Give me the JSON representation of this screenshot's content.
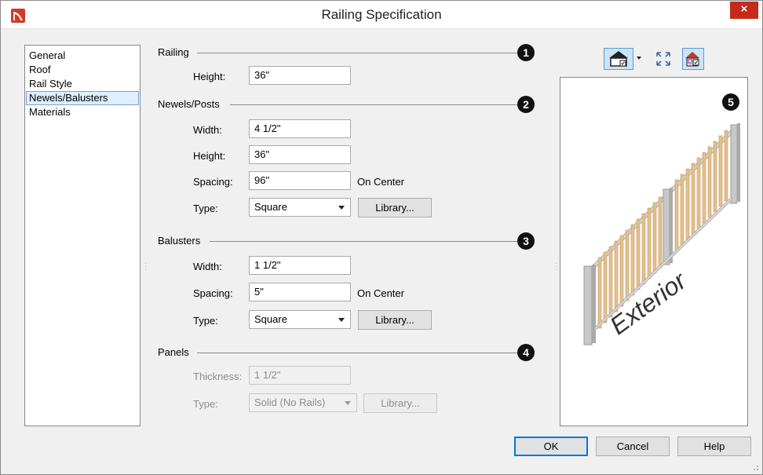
{
  "window": {
    "title": "Railing Specification",
    "close_glyph": "×"
  },
  "sidebar": {
    "items": [
      {
        "label": "General"
      },
      {
        "label": "Roof"
      },
      {
        "label": "Rail Style"
      },
      {
        "label": "Newels/Balusters",
        "selected": true
      },
      {
        "label": "Materials"
      }
    ]
  },
  "railing": {
    "title": "Railing",
    "badge": "1",
    "height_label": "Height:",
    "height_value": "36\""
  },
  "newels": {
    "title": "Newels/Posts",
    "badge": "2",
    "width_label": "Width:",
    "width_value": "4 1/2\"",
    "height_label": "Height:",
    "height_value": "36\"",
    "spacing_label": "Spacing:",
    "spacing_value": "96\"",
    "spacing_suffix": "On Center",
    "type_label": "Type:",
    "type_value": "Square",
    "library_label": "Library..."
  },
  "balusters": {
    "title": "Balusters",
    "badge": "3",
    "width_label": "Width:",
    "width_value": "1 1/2\"",
    "spacing_label": "Spacing:",
    "spacing_value": "5\"",
    "spacing_suffix": "On Center",
    "type_label": "Type:",
    "type_value": "Square",
    "library_label": "Library..."
  },
  "panels": {
    "title": "Panels",
    "badge": "4",
    "thickness_label": "Thickness:",
    "thickness_value": "1 1/2\"",
    "type_label": "Type:",
    "type_value": "Solid (No Rails)",
    "library_label": "Library..."
  },
  "preview": {
    "badge": "5",
    "label": "Exterior"
  },
  "toolbar": {
    "icons": [
      "camera-view-icon",
      "fill-window-icon",
      "render-options-icon"
    ]
  },
  "footer": {
    "ok_label": "OK",
    "cancel_label": "Cancel",
    "help_label": "Help"
  },
  "colors": {
    "accent": "#0078d7",
    "close": "#c42b1c",
    "wood": "#e4c08d",
    "post": "#bfbfbf"
  }
}
